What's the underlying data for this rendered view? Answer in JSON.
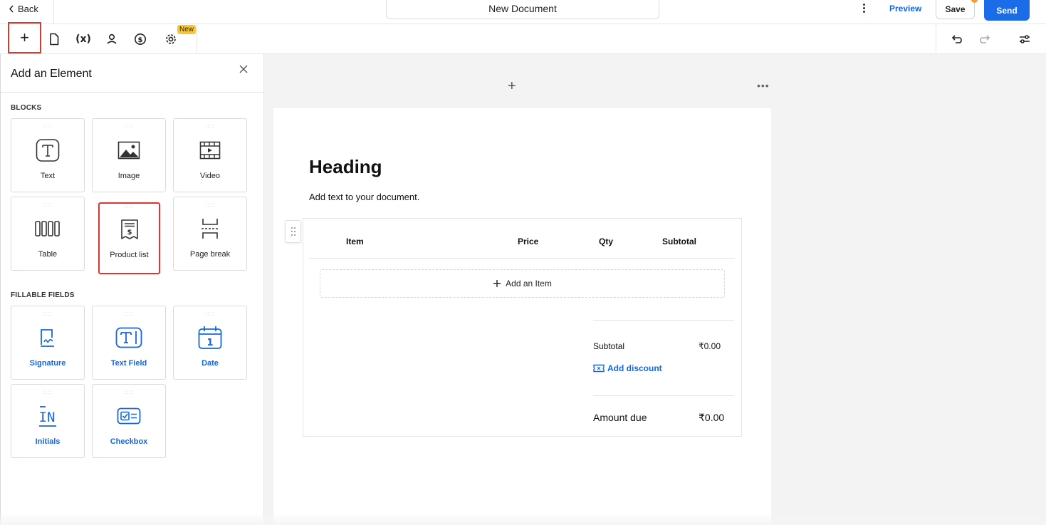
{
  "topbar": {
    "back_label": "Back",
    "document_title": "New Document",
    "preview_label": "Preview",
    "save_label": "Save",
    "send_label": "Send"
  },
  "toolbar": {
    "variables_label": "(x)",
    "new_badge": "New"
  },
  "panel": {
    "title": "Add an Element",
    "blocks_label": "BLOCKS",
    "blocks": [
      {
        "label": "Text",
        "icon": "text-icon"
      },
      {
        "label": "Image",
        "icon": "image-icon"
      },
      {
        "label": "Video",
        "icon": "video-icon"
      },
      {
        "label": "Table",
        "icon": "table-icon"
      },
      {
        "label": "Product list",
        "icon": "product-list-icon"
      },
      {
        "label": "Page break",
        "icon": "page-break-icon"
      }
    ],
    "fillable_label": "FILLABLE FIELDS",
    "fields": [
      {
        "label": "Signature",
        "icon": "signature-icon"
      },
      {
        "label": "Text Field",
        "icon": "text-field-icon"
      },
      {
        "label": "Date",
        "icon": "date-icon"
      },
      {
        "label": "Initials",
        "icon": "initials-icon"
      },
      {
        "label": "Checkbox",
        "icon": "checkbox-icon"
      }
    ]
  },
  "document": {
    "heading": "Heading",
    "body_text": "Add text to your document.",
    "product_table": {
      "columns": [
        "Item",
        "Price",
        "Qty",
        "Subtotal"
      ],
      "add_item_label": "Add an Item",
      "subtotal_label": "Subtotal",
      "subtotal_value": "₹0.00",
      "add_discount_label": "Add discount",
      "amount_due_label": "Amount due",
      "amount_due_value": "₹0.00"
    }
  },
  "colors": {
    "accent": "#1a6ce8",
    "highlight_border": "#e0352b",
    "badge": "#f6c63c"
  }
}
